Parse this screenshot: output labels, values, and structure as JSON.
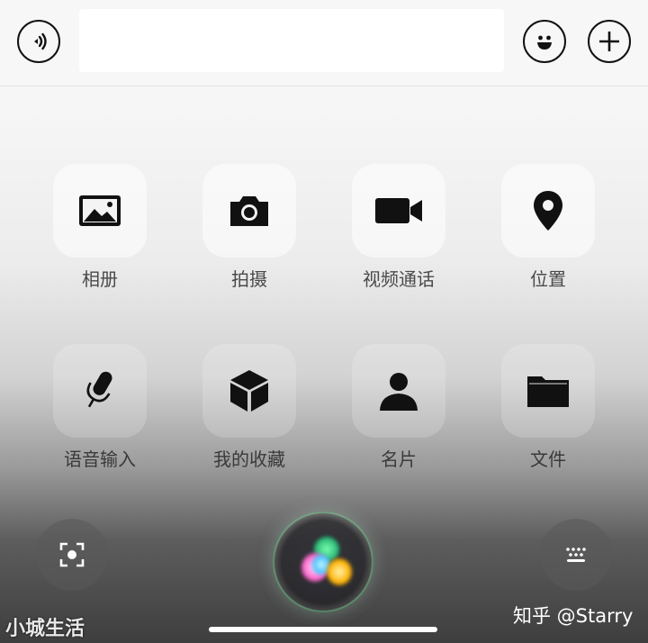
{
  "input_bar": {
    "value": "",
    "placeholder": "",
    "voice_icon": "voice-waves-icon",
    "emoji_icon": "smiley-icon",
    "plus_icon": "plus-icon"
  },
  "grid": {
    "row1": [
      {
        "label": "相册",
        "icon": "photo-album-icon"
      },
      {
        "label": "拍摄",
        "icon": "camera-icon"
      },
      {
        "label": "视频通话",
        "icon": "video-camera-icon"
      },
      {
        "label": "位置",
        "icon": "location-pin-icon"
      }
    ],
    "row2": [
      {
        "label": "语音输入",
        "icon": "microphone-icon"
      },
      {
        "label": "我的收藏",
        "icon": "cube-icon"
      },
      {
        "label": "名片",
        "icon": "person-icon"
      },
      {
        "label": "文件",
        "icon": "folder-icon"
      }
    ]
  },
  "bottom": {
    "scan_icon": "scan-icon",
    "keyboard_icon": "keyboard-icon",
    "orb_icon": "voice-assistant-orb"
  },
  "watermarks": {
    "left": "小城生活",
    "right": "知乎 @Starry"
  },
  "colors": {
    "icon": "#111111",
    "label": "#4a4a4a"
  }
}
